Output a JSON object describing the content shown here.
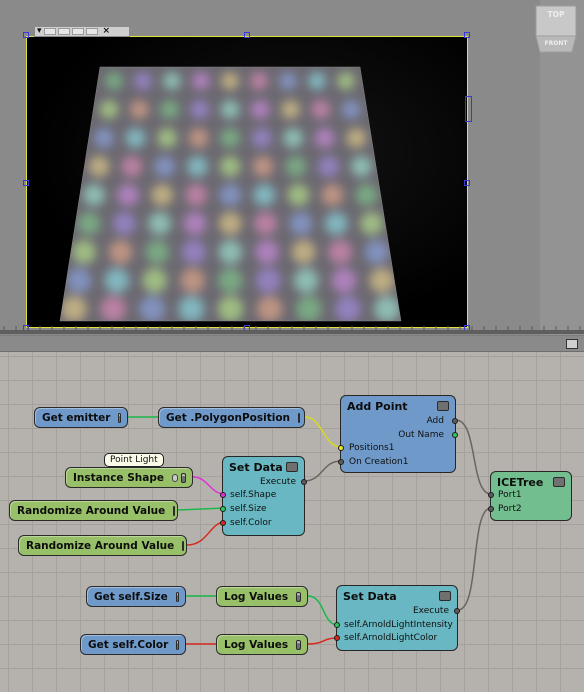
{
  "viewport": {
    "title_bar": {
      "menu_glyph": "▾",
      "close_glyph": "×",
      "buttons": [
        "",
        "",
        "",
        ""
      ]
    },
    "gizmo": {
      "top_label": "TOP",
      "front_label": "FRONT"
    }
  },
  "ice_tree": {
    "toolbar": {
      "maximize_icon": "panel-maximize-icon"
    },
    "tooltip": "Point Light",
    "nodes": {
      "get_emitter": "Get emitter",
      "get_polygon_position": "Get .PolygonPosition",
      "instance_shape": "Instance Shape",
      "randomize_1": "Randomize Around Value",
      "randomize_2": "Randomize Around Value",
      "get_self_size": "Get self.Size",
      "get_self_color": "Get self.Color",
      "log_values_1": "Log Values",
      "log_values_2": "Log Values",
      "add_point": {
        "title": "Add Point",
        "ports_out": [
          "Add",
          "Out Name"
        ],
        "ports_in": [
          "Positions1",
          "On Creation1"
        ]
      },
      "set_data_1": {
        "title": "Set Data",
        "port_out": "Execute",
        "ports_in": [
          "self.Shape",
          "self.Size",
          "self.Color"
        ]
      },
      "set_data_2": {
        "title": "Set Data",
        "port_out": "Execute",
        "ports_in": [
          "self.ArnoldLightIntensity",
          "self.ArnoldLightColor"
        ]
      },
      "ice_tree": {
        "title": "ICETree",
        "ports_in": [
          "Port1",
          "Port2"
        ]
      }
    },
    "colors": {
      "node_blue": "#6f99c9",
      "node_green": "#98c068",
      "node_teal": "#69b7c2",
      "node_ice": "#73be8f",
      "wire_green": "#19b84a",
      "wire_yellow": "#d8d820",
      "wire_magenta": "#e030d8",
      "wire_red": "#d42a20",
      "wire_gray": "#6a6560"
    }
  }
}
